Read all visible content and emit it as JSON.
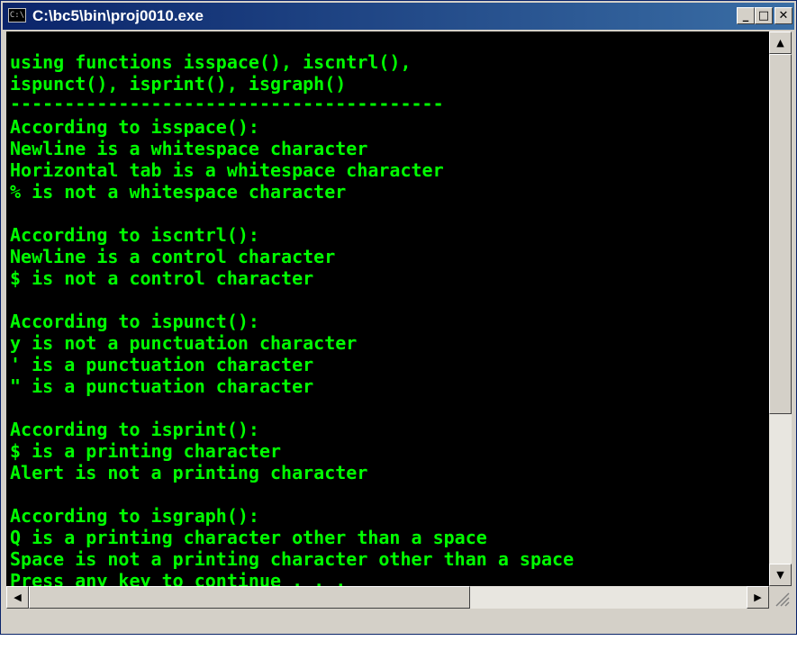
{
  "window": {
    "title": "C:\\bc5\\bin\\proj0010.exe",
    "icon_label": "C:\\",
    "controls": {
      "minimize": "_",
      "maximize": "□",
      "close": "✕"
    }
  },
  "console": {
    "lines": [
      "using functions isspace(), iscntrl(),",
      "ispunct(), isprint(), isgraph()",
      "----------------------------------------",
      "According to isspace():",
      "Newline is a whitespace character",
      "Horizontal tab is a whitespace character",
      "% is not a whitespace character",
      "",
      "According to iscntrl():",
      "Newline is a control character",
      "$ is not a control character",
      "",
      "According to ispunct():",
      "y is not a punctuation character",
      "' is a punctuation character",
      "\" is a punctuation character",
      "",
      "According to isprint():",
      "$ is a printing character",
      "Alert is not a printing character",
      "",
      "According to isgraph():",
      "Q is a printing character other than a space",
      "Space is not a printing character other than a space",
      "Press any key to continue . . ."
    ]
  },
  "scrollbars": {
    "up_arrow": "▲",
    "down_arrow": "▼",
    "left_arrow": "◀",
    "right_arrow": "▶"
  },
  "colors": {
    "title_gradient_start": "#0a246a",
    "title_gradient_end": "#3a6ea5",
    "console_background": "#000000",
    "console_text": "#00ff00"
  }
}
